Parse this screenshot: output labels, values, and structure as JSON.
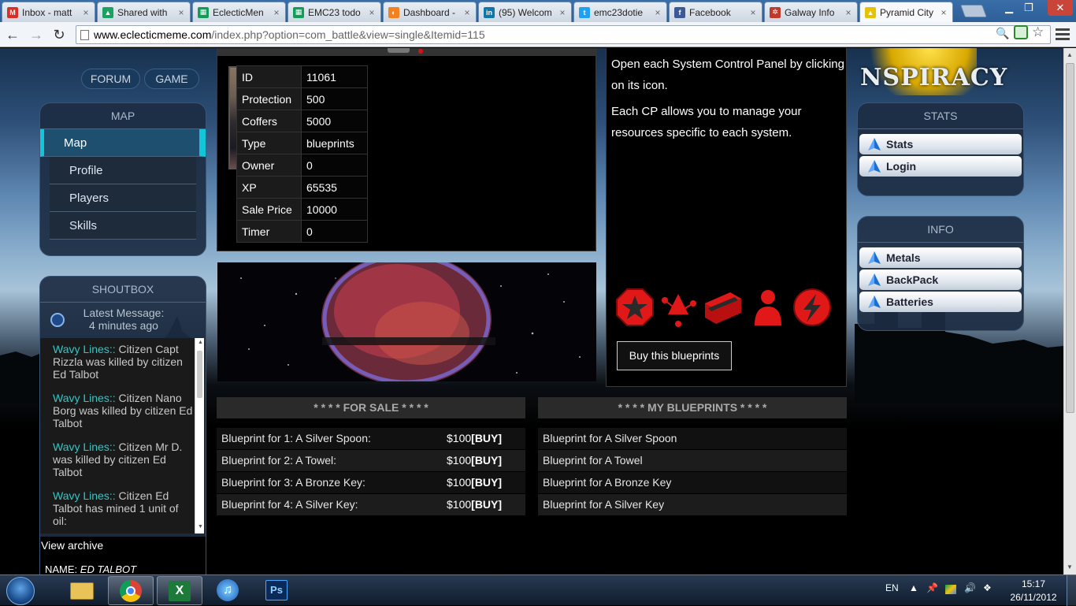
{
  "browser": {
    "tabs": [
      {
        "label": "Inbox - matt",
        "icon_color": "#d93025",
        "icon_char": "M"
      },
      {
        "label": "Shared with",
        "icon_color": "#1aa260",
        "icon_char": "▲"
      },
      {
        "label": "EclecticMen",
        "icon_color": "#0f9d58",
        "icon_char": "▦"
      },
      {
        "label": "EMC23 todo",
        "icon_color": "#0f9d58",
        "icon_char": "▦"
      },
      {
        "label": "Dashboard -",
        "icon_color": "#f48120",
        "icon_char": "◐"
      },
      {
        "label": "(95) Welcom",
        "icon_color": "#0e76a8",
        "icon_char": "in"
      },
      {
        "label": "emc23dotie",
        "icon_color": "#1da1f2",
        "icon_char": "t"
      },
      {
        "label": "Facebook",
        "icon_color": "#3b5998",
        "icon_char": "f"
      },
      {
        "label": "Galway Info",
        "icon_color": "#c0392b",
        "icon_char": "✲"
      },
      {
        "label": "Pyramid City",
        "icon_color": "#e6c300",
        "icon_char": "▲"
      }
    ],
    "close_char": "×",
    "url_host": "www.eclecticmeme.com",
    "url_path": "/index.php?option=com_battle&view=single&Itemid=115"
  },
  "topnav": {
    "forum": "FORUM",
    "game": "GAME"
  },
  "map_panel": {
    "title": "MAP",
    "items": [
      "Map",
      "Profile",
      "Players",
      "Skills"
    ]
  },
  "shoutbox": {
    "title": "SHOUTBOX",
    "latest_label": "Latest Message:",
    "latest_time": "4 minutes ago",
    "messages": [
      {
        "who": "Wavy Lines::",
        "text": " Citizen Capt Rizzla was killed by citizen Ed Talbot"
      },
      {
        "who": "Wavy Lines::",
        "text": " Citizen Nano Borg was killed by citizen Ed Talbot"
      },
      {
        "who": "Wavy Lines::",
        "text": " Citizen Mr D. was killed by citizen Ed Talbot"
      },
      {
        "who": "Wavy Lines::",
        "text": " Citizen Ed Talbot has mined 1 unit of oil:"
      }
    ],
    "archive": "View archive",
    "name_label": "NAME:",
    "name_value": "ED TALBOT"
  },
  "item_stats": [
    {
      "key": "ID",
      "value": "11061"
    },
    {
      "key": "Protection",
      "value": "500"
    },
    {
      "key": "Coffers",
      "value": "5000"
    },
    {
      "key": "Type",
      "value": "blueprints"
    },
    {
      "key": "Owner",
      "value": "0"
    },
    {
      "key": "XP",
      "value": "65535"
    },
    {
      "key": "Sale Price",
      "value": "10000"
    },
    {
      "key": "Timer",
      "value": "0"
    }
  ],
  "control_panel": {
    "text1": "Open each System Control Panel by clicking on its icon.",
    "text2": "Each CP allows you to manage your resources specific to each system.",
    "icons": [
      "star-octagon-icon",
      "molecule-icon",
      "battery-icon",
      "person-icon",
      "lightning-icon"
    ],
    "buy_label": "Buy this blueprints"
  },
  "for_sale": {
    "header": "* * * * FOR SALE * * * *",
    "rows": [
      {
        "name": "Blueprint for 1: A Silver Spoon:",
        "price": "$100",
        "buy": "[BUY]"
      },
      {
        "name": "Blueprint for 2: A Towel:",
        "price": "$100",
        "buy": "[BUY]"
      },
      {
        "name": "Blueprint for 3: A Bronze Key:",
        "price": "$100",
        "buy": "[BUY]"
      },
      {
        "name": "Blueprint for 4: A Silver Key:",
        "price": "$100",
        "buy": "[BUY]"
      }
    ]
  },
  "my_blueprints": {
    "header": "* * * * MY BLUEPRINTS * * * *",
    "rows": [
      "Blueprint for A Silver Spoon",
      "Blueprint for A Towel",
      "Blueprint for A Bronze Key",
      "Blueprint for A Silver Key"
    ]
  },
  "banner_text": "NSPIRACY",
  "stats_panel": {
    "title": "STATS",
    "items": [
      "Stats",
      "Login"
    ]
  },
  "info_panel": {
    "title": "INFO",
    "items": [
      "Metals",
      "BackPack",
      "Batteries"
    ]
  },
  "taskbar": {
    "lang": "EN",
    "time": "15:17",
    "date": "26/11/2012",
    "ps_label": "Ps"
  },
  "colors": {
    "accent_cyan": "#10c6d8",
    "cp_red": "#e01818"
  }
}
